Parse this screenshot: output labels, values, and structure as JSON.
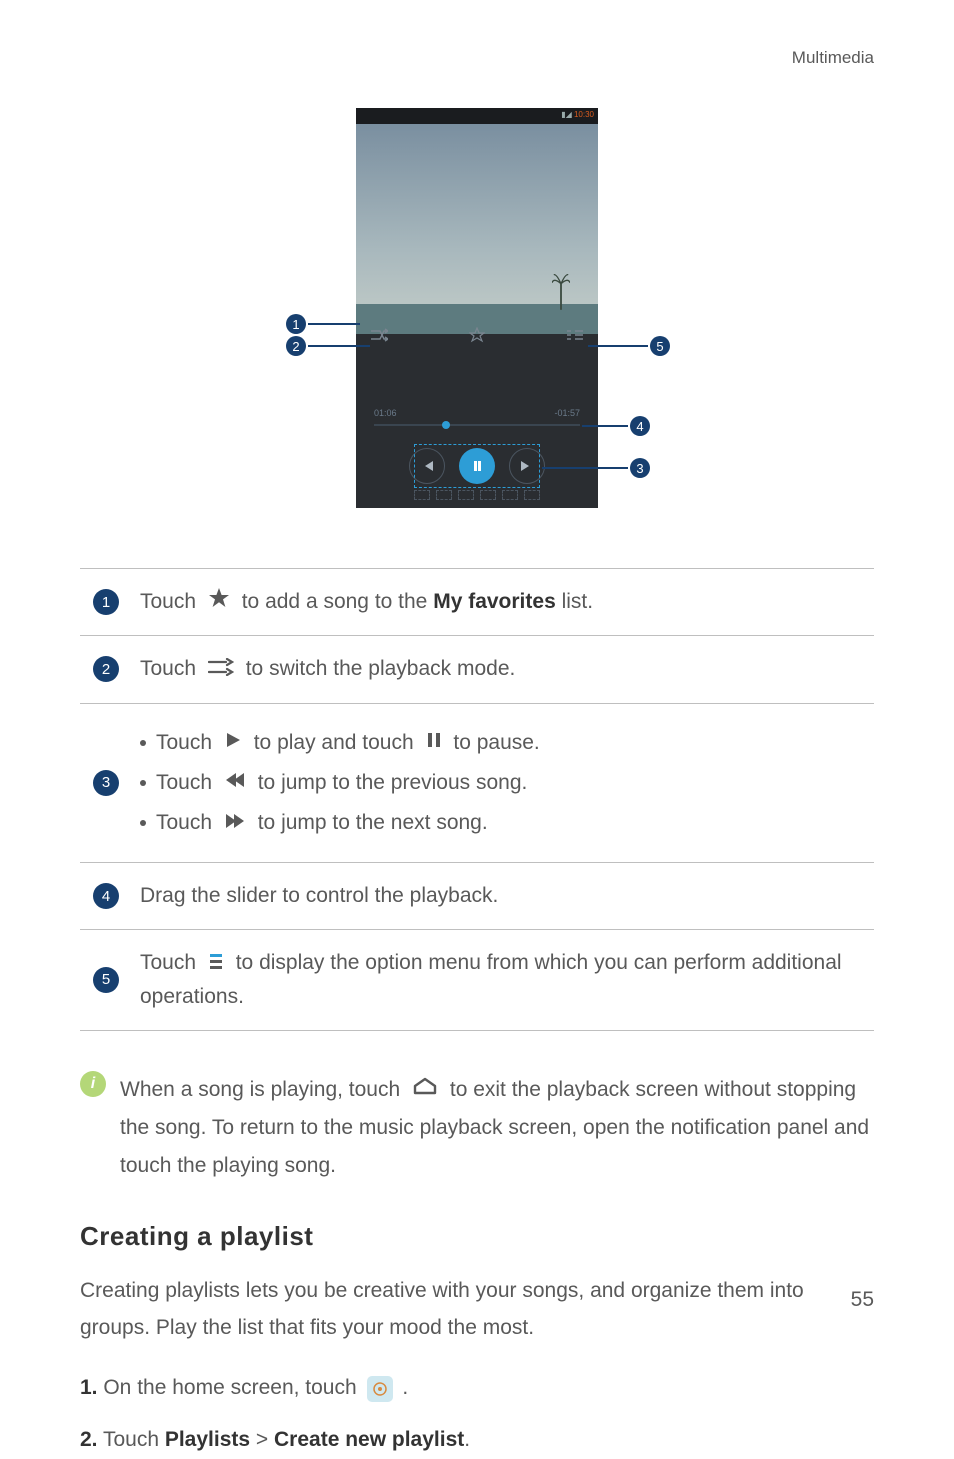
{
  "header": {
    "section": "Multimedia"
  },
  "screenshot": {
    "statusTime": "10:30",
    "timeElapsed": "01:06",
    "timeRemaining": "-01:57"
  },
  "callouts": {
    "c1": "1",
    "c2": "2",
    "c3": "3",
    "c4": "4",
    "c5": "5"
  },
  "table": {
    "r1": {
      "num": "1",
      "pre": "Touch ",
      "post": " to add a song to the ",
      "bold": "My favorites",
      "tail": " list."
    },
    "r2": {
      "num": "2",
      "pre": "Touch ",
      "post": "to switch the playback mode."
    },
    "r3": {
      "num": "3",
      "b1a": "Touch ",
      "b1b": "to play and touch ",
      "b1c": " to pause.",
      "b2a": "Touch ",
      "b2b": "to jump to the previous song.",
      "b3a": "Touch ",
      "b3b": "to jump to the next song."
    },
    "r4": {
      "num": "4",
      "text": "Drag the slider to control the playback."
    },
    "r5": {
      "num": "5",
      "pre": "Touch ",
      "post": " to display the option menu from which you can perform additional operations."
    }
  },
  "note": {
    "pre": "When a song is playing, touch ",
    "post": "to exit the playback screen without stopping the song. To return to the music playback screen, open the notification panel and touch the playing song."
  },
  "section": {
    "heading": "Creating a playlist",
    "para": "Creating playlists lets you be creative with your songs, and organize them into groups. Play the list that fits your mood the most.",
    "step1num": "1.",
    "step1": " On the home screen, touch ",
    "step1tail": " .",
    "step2num": "2.",
    "step2pre": " Touch ",
    "step2a": "Playlists",
    "step2mid": " > ",
    "step2b": "Create new playlist",
    "step2tail": "."
  },
  "pageNumber": "55"
}
